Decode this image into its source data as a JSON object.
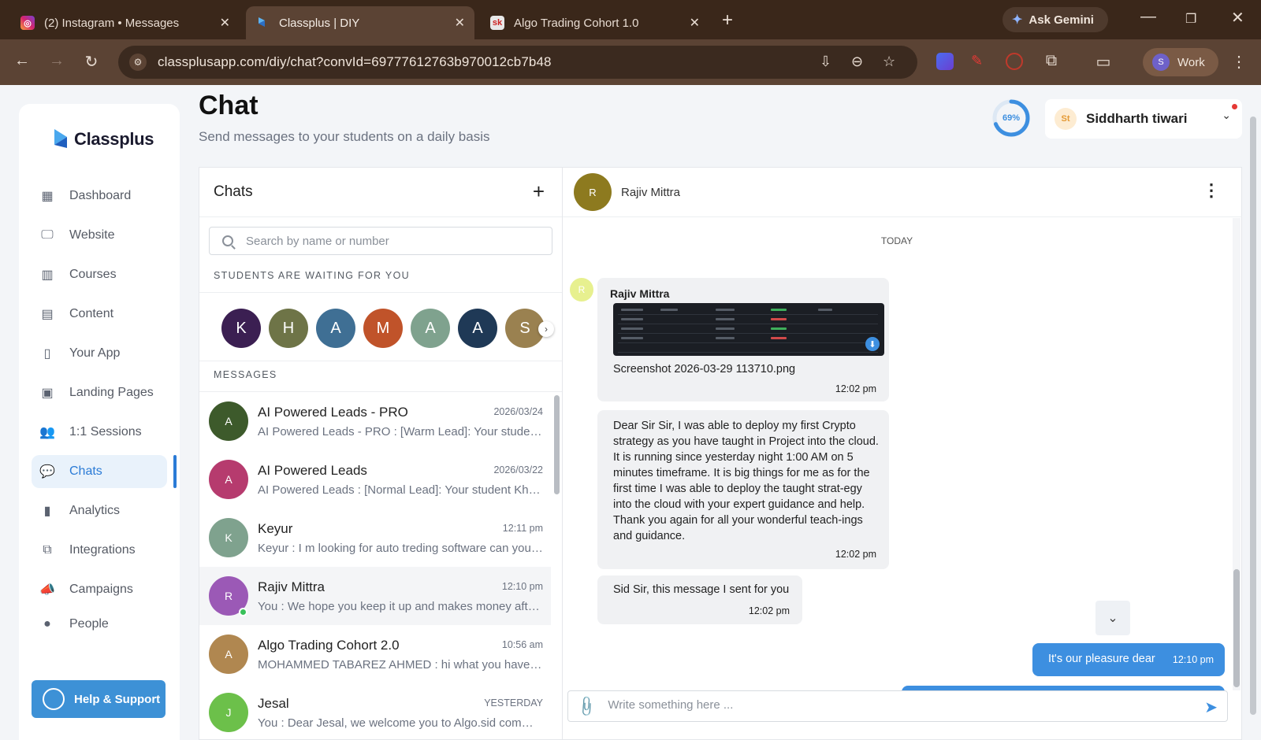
{
  "browser": {
    "tabs": [
      {
        "title": "(2) Instagram • Messages",
        "icon": "instagram-icon",
        "active": false
      },
      {
        "title": "Classplus | DIY",
        "icon": "classplus-icon",
        "active": true
      },
      {
        "title": "Algo Trading Cohort 1.0",
        "icon": "sk-icon",
        "favicon_text": "sk",
        "active": false
      }
    ],
    "ask_gemini": "Ask Gemini",
    "url": "classplusapp.com/diy/chat?convId=69777612763b970012cb7b48",
    "profile_initial": "S",
    "profile_label": "Work"
  },
  "sidebar": {
    "logo_text": "Classplus",
    "items": [
      {
        "label": "Dashboard",
        "icon": "dashboard-icon"
      },
      {
        "label": "Website",
        "icon": "website-icon"
      },
      {
        "label": "Courses",
        "icon": "courses-icon"
      },
      {
        "label": "Content",
        "icon": "content-icon"
      },
      {
        "label": "Your App",
        "icon": "app-icon"
      },
      {
        "label": "Landing Pages",
        "icon": "landing-pages-icon"
      },
      {
        "label": "1:1 Sessions",
        "icon": "sessions-icon"
      },
      {
        "label": "Chats",
        "icon": "chats-icon",
        "active": true
      },
      {
        "label": "Analytics",
        "icon": "analytics-icon"
      },
      {
        "label": "Integrations",
        "icon": "integrations-icon"
      },
      {
        "label": "Campaigns",
        "icon": "campaigns-icon"
      },
      {
        "label": "People",
        "icon": "people-icon"
      }
    ],
    "help_label": "Help & Support"
  },
  "header": {
    "title": "Chat",
    "subtitle": "Send messages to your students on a daily basis",
    "progress_text": "69%",
    "progress_value": 0.69,
    "user_initials": "St",
    "user_name": "Siddharth tiwari"
  },
  "chats": {
    "title": "Chats",
    "search_placeholder": "Search by name or number",
    "waiting_label": "STUDENTS ARE WAITING FOR YOU",
    "waiting": [
      {
        "initial": "K",
        "color": "#3b1f52"
      },
      {
        "initial": "H",
        "color": "#6e7447"
      },
      {
        "initial": "A",
        "color": "#3f6f94"
      },
      {
        "initial": "M",
        "color": "#c0532a"
      },
      {
        "initial": "A",
        "color": "#7fa28e"
      },
      {
        "initial": "A",
        "color": "#1f3956"
      },
      {
        "initial": "S",
        "color": "#9a8150"
      }
    ],
    "messages_label": "MESSAGES",
    "messages": [
      {
        "initial": "A",
        "color": "#3d5a2b",
        "name": "AI Powered Leads - PRO",
        "time": "2026/03/24",
        "preview": "AI Powered Leads - PRO : [Warm Lead]: Your student ..."
      },
      {
        "initial": "A",
        "color": "#b63b6e",
        "name": "AI Powered Leads",
        "time": "2026/03/22",
        "preview": "AI Powered Leads : [Normal Lead]: Your student Khus..."
      },
      {
        "initial": "K",
        "color": "#7fa28e",
        "name": "Keyur",
        "time": "12:11 pm",
        "preview": "Keyur : I m looking for auto treding software can you ..."
      },
      {
        "initial": "R",
        "color": "#9b59b6",
        "name": "Rajiv Mittra",
        "time": "12:10 pm",
        "preview": "You : We hope you keep it up and makes money after ...",
        "selected": true,
        "online": true
      },
      {
        "initial": "A",
        "color": "#b08750",
        "name": "Algo Trading Cohort 2.0",
        "time": "10:56 am",
        "preview": "MOHAMMED TABAREZ AHMED : hi what you have to d..."
      },
      {
        "initial": "J",
        "color": "#6cc04a",
        "name": "Jesal",
        "time": "YESTERDAY",
        "preview": "You : Dear Jesal, we welcome you to Algo.sid commun..."
      }
    ]
  },
  "conversation": {
    "contact_initial": "R",
    "contact_name": "Rajiv Mittra",
    "day_label": "TODAY",
    "sender_initial": "R",
    "message1": {
      "sender": "Rajiv Mittra",
      "file_name": "Screenshot 2026-03-29 113710.png",
      "time": "12:02 pm"
    },
    "message2": {
      "text": "Dear Sir Sir, I was able to deploy my first Crypto strategy as you have taught in Project into the cloud. It is running since yesterday night 1:00 AM on 5 minutes timeframe. It is big things for me as for the first time I was able to deploy the taught strat-egy into the cloud with your expert guidance and help. Thank you again for all your wonderful teach-ings and guidance.",
      "time": "12:02 pm"
    },
    "message3": {
      "text": "Sid Sir, this message I sent for you",
      "time": "12:02 pm"
    },
    "reply1": {
      "text": "It's our pleasure dear",
      "time": "12:10 pm"
    },
    "composer_placeholder": "Write something here ..."
  },
  "colors": {
    "accent": "#3d8fe0",
    "chrome_dark": "#3a271a",
    "chrome_toolbar": "#5b4334"
  }
}
